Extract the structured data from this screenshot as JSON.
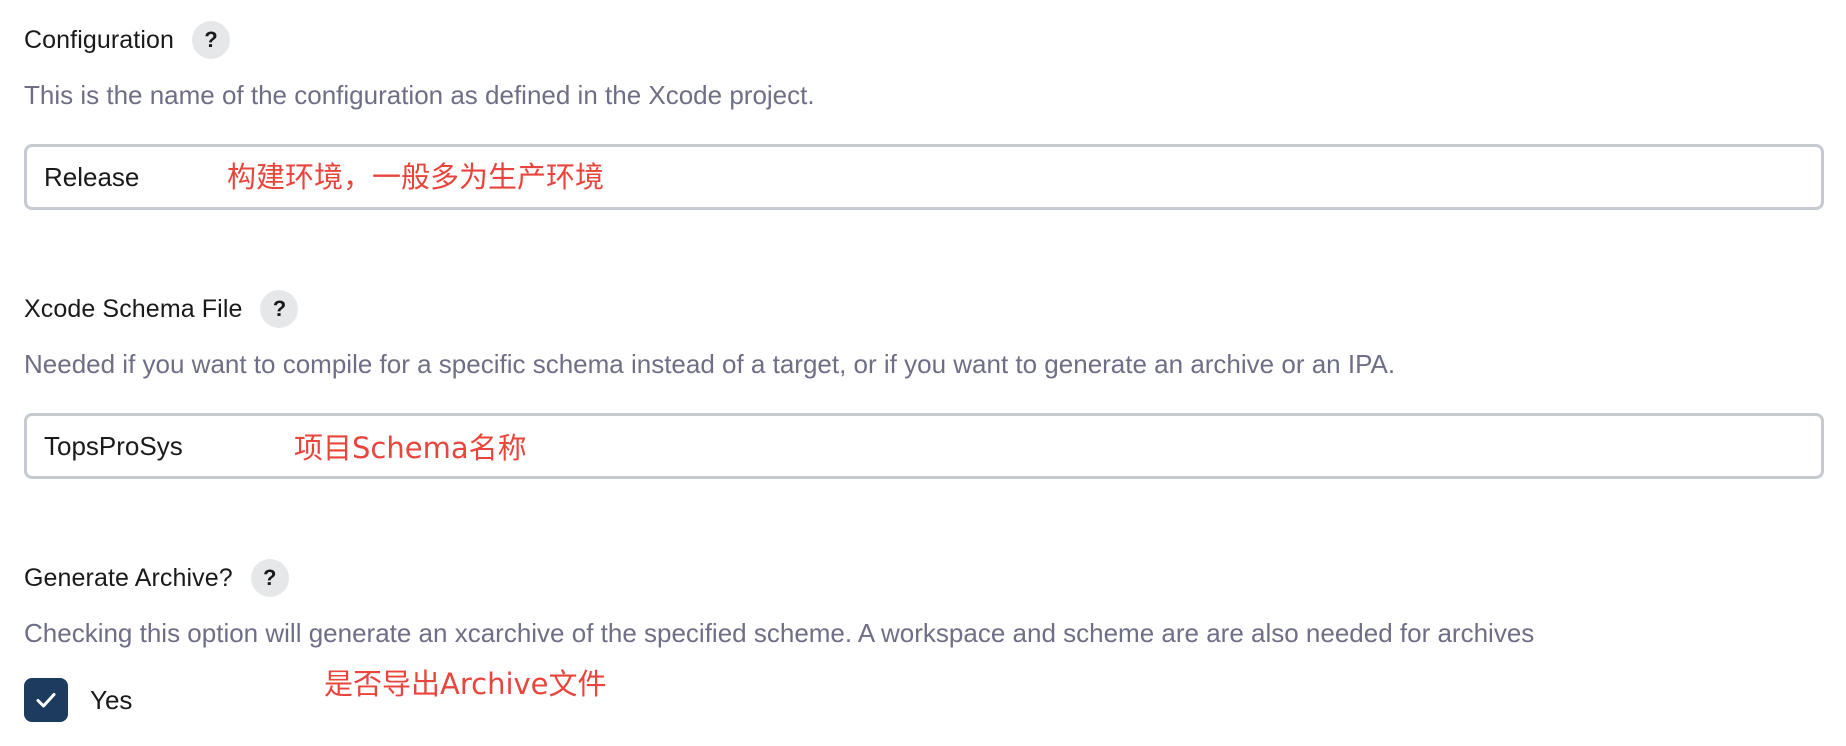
{
  "configuration": {
    "label": "Configuration",
    "help": "?",
    "description": "This is the name of the configuration as defined in the Xcode project.",
    "value": "Release",
    "annotation": "构建环境，一般多为生产环境"
  },
  "schema": {
    "label": "Xcode Schema File",
    "help": "?",
    "description": "Needed if you want to compile for a specific schema instead of a target, or if you want to generate an archive or an IPA.",
    "value": "TopsProSys",
    "annotation": "项目Schema名称"
  },
  "archive": {
    "label": "Generate Archive?",
    "help": "?",
    "description": "Checking this option will generate an xcarchive of the specified scheme. A workspace and scheme are are also needed for archives",
    "checkbox_label": "Yes",
    "checked": true,
    "annotation": "是否导出Archive文件"
  },
  "colors": {
    "annotation": "#e8453c",
    "checkbox": "#1d3b5c",
    "description": "#6e6f86",
    "input_border": "#c5cbd0"
  }
}
